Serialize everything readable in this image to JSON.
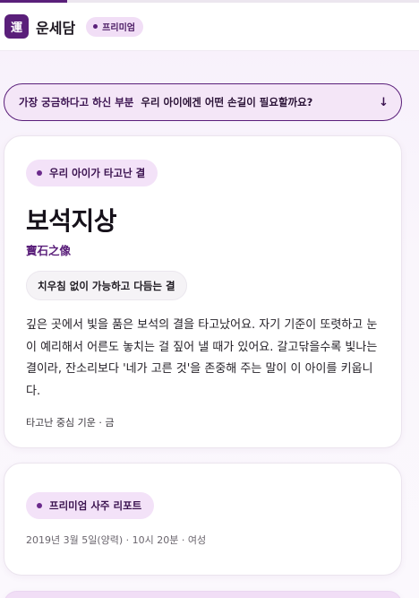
{
  "progress": 0.16,
  "colors": {
    "brand": "#5a1f7a",
    "chip_bg": "#f3e2f8",
    "page_bg": "#faf6fc"
  },
  "header": {
    "logo_char": "運",
    "app_name": "운세담",
    "badge": "프리미엄"
  },
  "question_bar": {
    "label": "가장 궁금하다고 하신 부분",
    "question": "우리 아이에겐 어떤 손길이 필요할까요?",
    "icon": "arrow-down-icon"
  },
  "main_card": {
    "chip": "우리 아이가 타고난 결",
    "title": "보석지상",
    "hanja": "寶石之像",
    "tag": "치우침 없이 가능하고 다듬는 결",
    "description": "깊은 곳에서 빛을 품은 보석의 결을 타고났어요. 자기 기준이 또렷하고 눈이 예리해서 어른도 놓치는 걸 짚어 낼 때가 있어요. 갈고닦을수록 빛나는 결이라, 잔소리보다 '네가 고른 것'을 존중해 주는 말이 이 아이를 키웁니다.",
    "footer": "타고난 중심 기운 · 금"
  },
  "report_card": {
    "chip": "프리미엄 사주 리포트",
    "meta": "2019년 3월 5일(양력) · 10시 20분 · 여성"
  }
}
